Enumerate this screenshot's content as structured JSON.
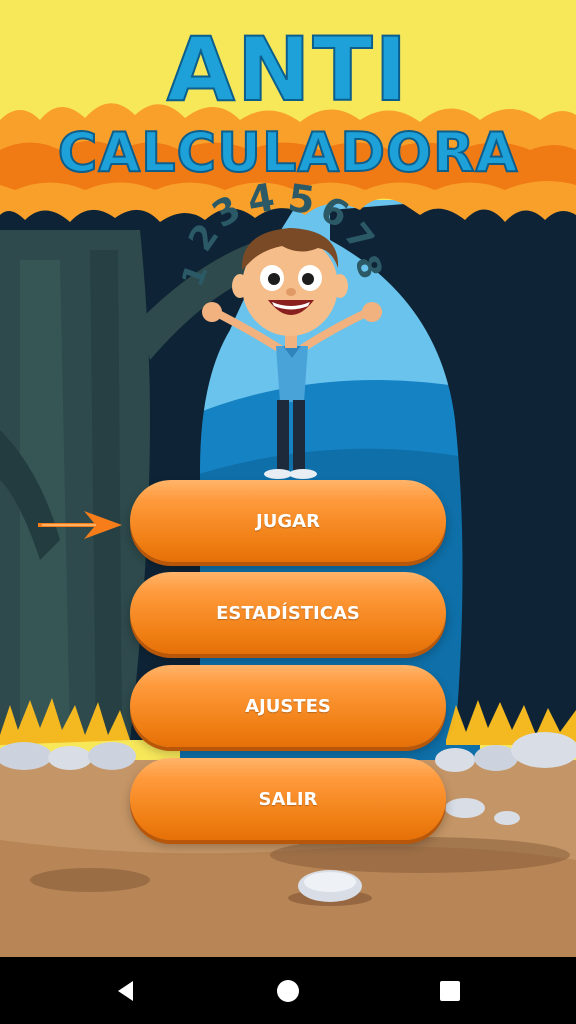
{
  "title": {
    "line1": "ANTI",
    "line2": "CALCULADORA"
  },
  "numbers_arc": "12345678",
  "menu": {
    "jugar": "JUGAR",
    "estadisticas": "ESTADÍSTICAS",
    "ajustes": "AJUSTES",
    "salir": "SALIR"
  },
  "icons": {
    "pointer": "arrow-right-icon",
    "nav_back": "back-triangle-icon",
    "nav_home": "home-circle-icon",
    "nav_recent": "recent-square-icon"
  },
  "colors": {
    "title": "#1ea0d8",
    "button": "#f08018",
    "sky_yellow": "#f7e85a",
    "foliage": "#f9a02a",
    "tree_dark": "#0e2436",
    "ground": "#c49566",
    "navbar": "#000000"
  }
}
